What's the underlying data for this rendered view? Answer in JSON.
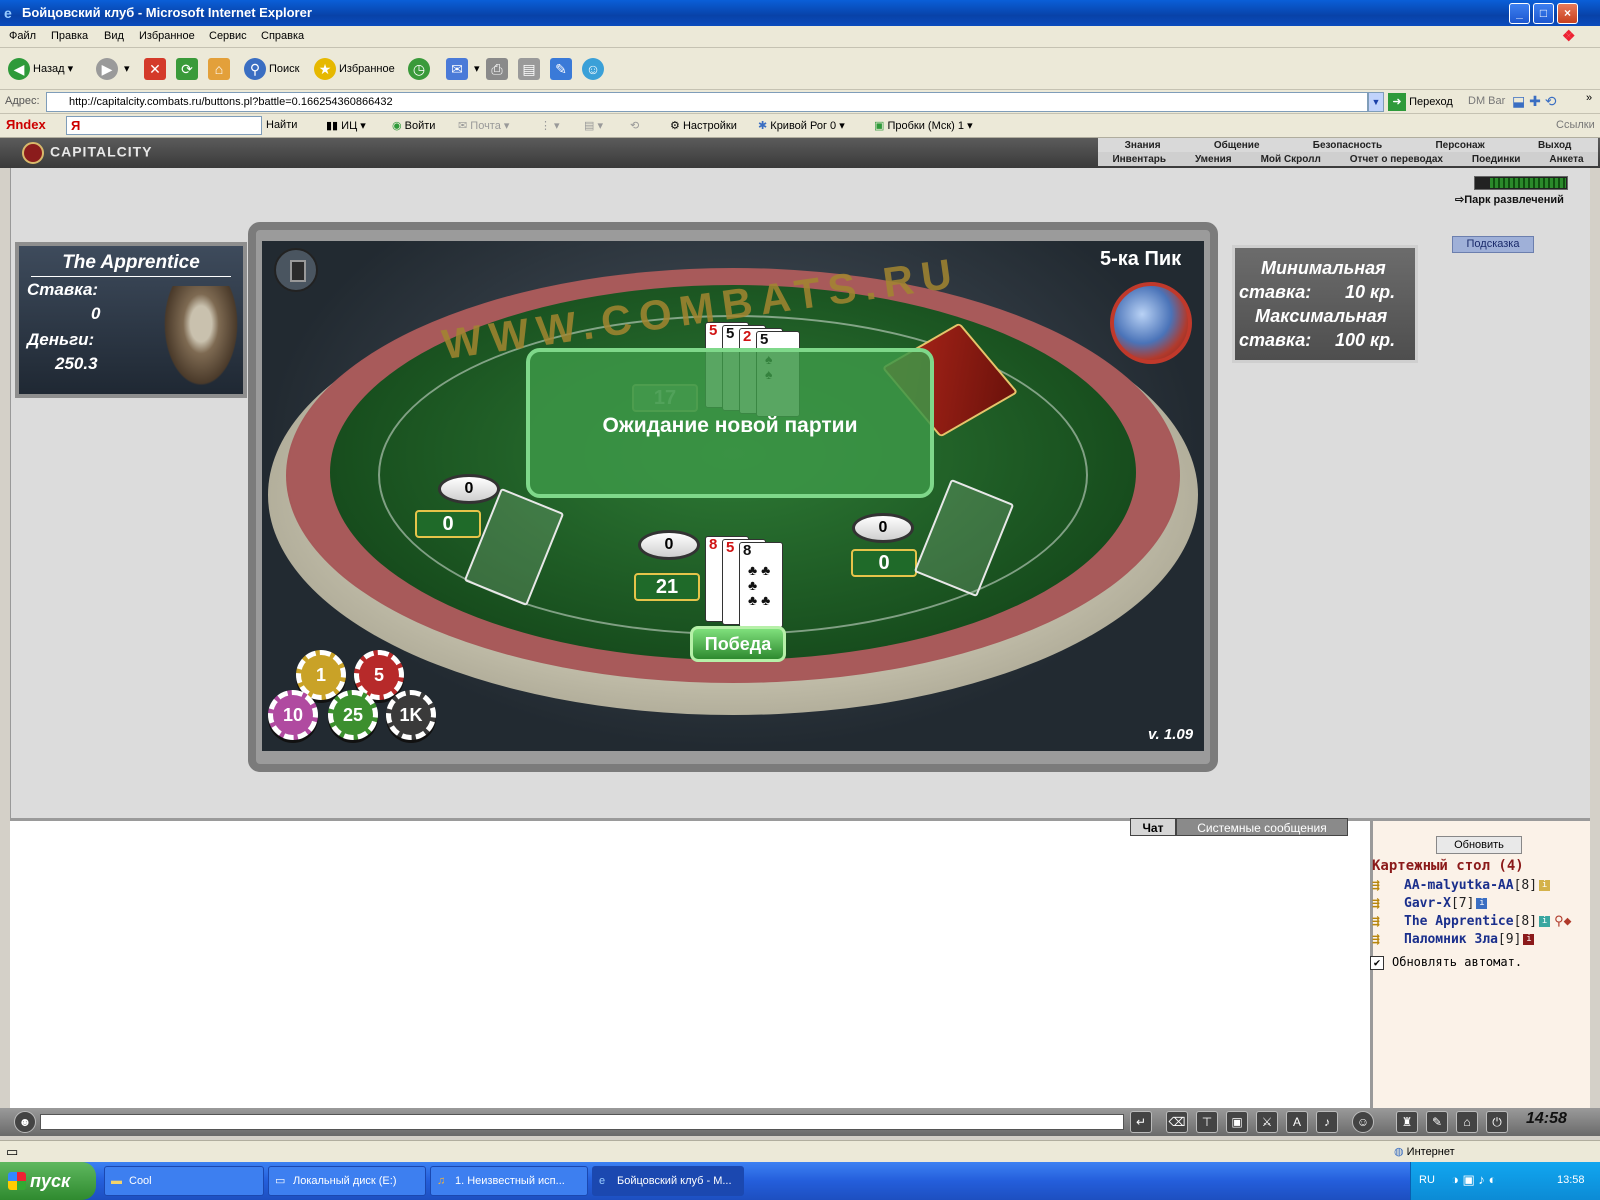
{
  "window": {
    "title": "Бойцовский клуб - Microsoft Internet Explorer",
    "buttons": {
      "minimize": "_",
      "maximize": "□",
      "close": "×"
    }
  },
  "menu": [
    "Файл",
    "Правка",
    "Вид",
    "Избранное",
    "Сервис",
    "Справка"
  ],
  "toolbar": {
    "back": "Назад",
    "search": "Поиск",
    "favorites": "Избранное"
  },
  "address": {
    "label": "Адрес:",
    "url": "http://capitalcity.combats.ru/buttons.pl?battle=0.166254360866432",
    "go": "Переход",
    "dmbar": "DM Bar"
  },
  "yandex": {
    "brand": "Яndex",
    "find": "Найти",
    "ic": "ИЦ",
    "login": "Войти",
    "mail": "Почта",
    "settings": "Настройки",
    "weather": "Кривой Рог 0",
    "traffic": "Пробки (Мск) 1",
    "links": "Ссылки"
  },
  "game_nav": {
    "logo": "CAPITALCITY",
    "row1": [
      "Знания",
      "Общение",
      "Безопасность",
      "Персонаж",
      "Выход"
    ],
    "row2": [
      "Инвентарь",
      "Умения",
      "Мой Скролл",
      "Отчет о переводах",
      "Поединки",
      "Анкета"
    ],
    "park": "Парк развлечений",
    "hint": "Подсказка"
  },
  "player": {
    "name": "The Apprentice",
    "bet_label": "Ставка:",
    "bet_value": "0",
    "money_label": "Деньги:",
    "money_value": "250.3"
  },
  "game": {
    "title": "5-ка Пик",
    "table_text": "WWW.COMBATS.RU",
    "version": "v. 1.09",
    "overlay_message": "Ожидание новой партии",
    "win_label": "Победа",
    "dealer_score": "17",
    "left_seat": {
      "bet": "0",
      "score": "0"
    },
    "player_seat": {
      "bet": "0",
      "score": "21"
    },
    "right_seat": {
      "bet": "0",
      "score": "0"
    },
    "dealer_cards": [
      {
        "rank": "5",
        "color": "red"
      },
      {
        "rank": "5",
        "color": "black"
      },
      {
        "rank": "2",
        "color": "red"
      },
      {
        "rank": "5",
        "color": "black"
      }
    ],
    "player_cards": [
      {
        "rank": "8",
        "color": "red"
      },
      {
        "rank": "5",
        "color": "red"
      },
      {
        "rank": "8",
        "color": "black"
      }
    ],
    "chips": [
      {
        "label": "1",
        "color": "#c9a227"
      },
      {
        "label": "5",
        "color": "#b72a2a"
      },
      {
        "label": "10",
        "color": "#b04aa0"
      },
      {
        "label": "25",
        "color": "#3c8f2e"
      },
      {
        "label": "1K",
        "color": "#3a3a3a"
      }
    ]
  },
  "stakes": {
    "min_label": "Минимальная",
    "min_prefix": "ставка:",
    "min_value": "10 кр.",
    "max_label": "Максимальная",
    "max_prefix": "ставка:",
    "max_value": "100 кр."
  },
  "chat": {
    "tabs": [
      "Чат",
      "Системные сообщения"
    ]
  },
  "room": {
    "refresh": "Обновить",
    "title": "Картежный стол (4)",
    "players": [
      {
        "name": "AA-malyutka-AA",
        "level": "[8]"
      },
      {
        "name": "Gavr-X",
        "level": "[7]"
      },
      {
        "name": "The Apprentice",
        "level": "[8]"
      },
      {
        "name": "Паломник Зла",
        "level": "[9]"
      }
    ],
    "auto_refresh": "Обновлять автомат."
  },
  "chatbar": {
    "clock": "14:58"
  },
  "statusbar": {
    "zone": "Интернет"
  },
  "taskbar": {
    "start": "пуск",
    "items": [
      "Cool",
      "Локальный диск (E:)",
      "1. Неизвестный исп...",
      "Бойцовский клуб - M..."
    ],
    "lang": "RU",
    "time": "13:58"
  },
  "colors": {
    "felt": "#1f6a29",
    "rim": "#a85a5a",
    "accent_gold": "#e6c44a",
    "player_name": "#1a2f8c",
    "room_title": "#8b1a1a"
  }
}
